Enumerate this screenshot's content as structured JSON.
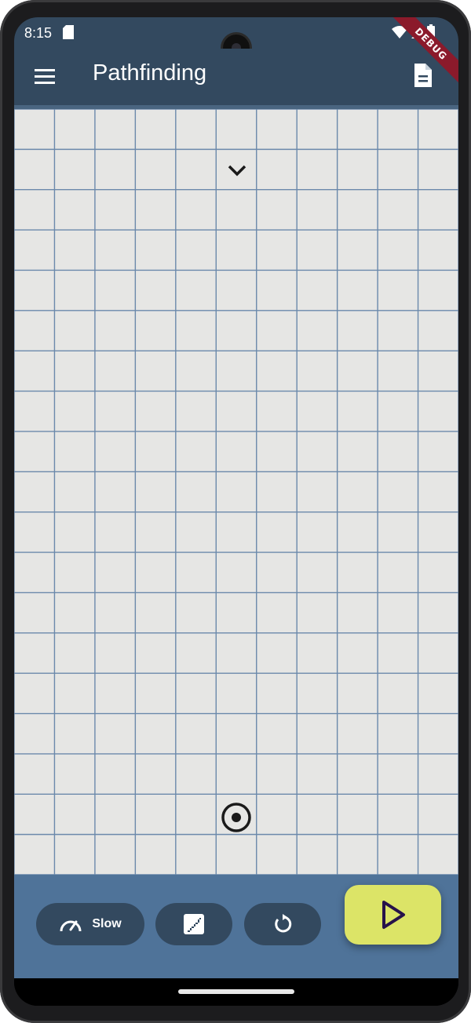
{
  "status_bar": {
    "time": "8:15",
    "icons": [
      "sd-card-icon",
      "wifi-icon",
      "signal-icon",
      "battery-icon"
    ],
    "debug_banner": "DEBUG"
  },
  "app_bar": {
    "title": "Pathfinding",
    "menu_icon": "menu-icon",
    "action_icon": "document-icon",
    "background": "#33495f"
  },
  "grid": {
    "columns": 11,
    "rows": 19,
    "cell_color": "#e6e6e4",
    "line_color": "#6b89ab",
    "start": {
      "column": 6,
      "row": 2,
      "icon": "chevron-down-icon"
    },
    "target": {
      "column": 6,
      "row": 18,
      "icon": "target-icon"
    }
  },
  "controls": {
    "speed_label": "Slow",
    "speed_icon": "speedometer-icon",
    "step_icon": "stairs-icon",
    "reset_icon": "refresh-icon",
    "play_icon": "play-icon",
    "bar_color": "#4f7399",
    "pill_color": "#33495f",
    "play_color": "#dce467"
  }
}
